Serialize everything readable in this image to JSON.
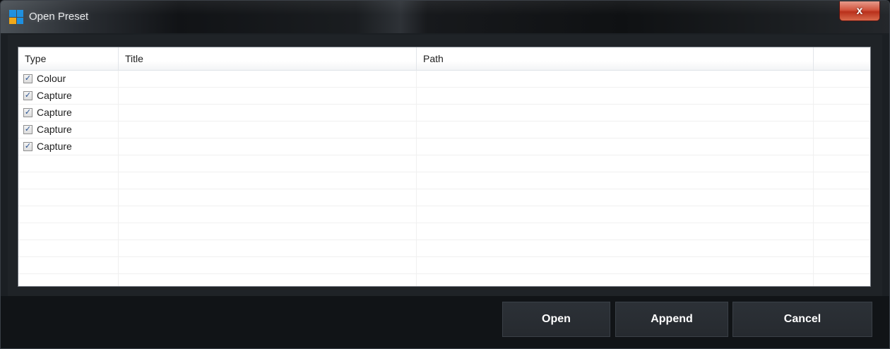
{
  "window": {
    "title": "Open Preset",
    "close_glyph": "x",
    "icon": "app-grid-icon",
    "icon_colors": [
      "#1e90e0",
      "#1e90e0",
      "#f0a818",
      "#1e90e0"
    ]
  },
  "list": {
    "columns": [
      {
        "label": "Type"
      },
      {
        "label": "Title"
      },
      {
        "label": "Path"
      },
      {
        "label": ""
      }
    ],
    "rows": [
      {
        "type": "Colour",
        "checked": true,
        "title": "",
        "path": ""
      },
      {
        "type": "Capture",
        "checked": true,
        "title": "",
        "path": ""
      },
      {
        "type": "Capture",
        "checked": true,
        "title": "",
        "path": ""
      },
      {
        "type": "Capture",
        "checked": true,
        "title": "",
        "path": ""
      },
      {
        "type": "Capture",
        "checked": true,
        "title": "",
        "path": ""
      }
    ],
    "check_glyph": "✓"
  },
  "buttons": {
    "open": "Open",
    "append": "Append",
    "cancel": "Cancel"
  }
}
